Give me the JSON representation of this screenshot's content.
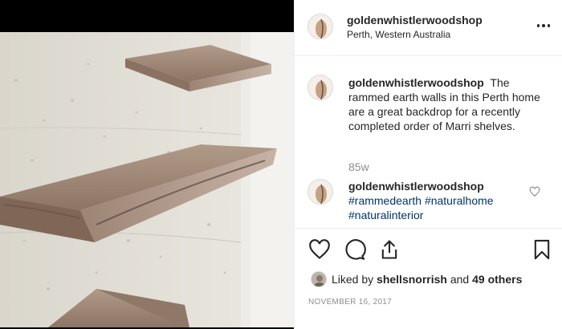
{
  "post": {
    "username": "goldenwhistlerwoodshop",
    "location": "Perth, Western Australia",
    "image_alt": "Marri timber floating shelves on a rammed earth wall"
  },
  "caption": {
    "username": "goldenwhistlerwoodshop",
    "text": "The rammed earth walls in this Perth home are a great backdrop for a recently completed order of Marri shelves.",
    "time_ago": "85w"
  },
  "comment": {
    "username": "goldenwhistlerwoodshop",
    "hashtags": [
      "#rammedearth",
      "#naturalhome",
      "#naturalinterior"
    ]
  },
  "likes": {
    "prefix": "Liked by",
    "user": "shellsnorrish",
    "connector": "and",
    "others": "49 others"
  },
  "date": "November 16, 2017",
  "icons": {
    "more": "more-options-icon",
    "like": "heart-icon",
    "comment": "comment-bubble-icon",
    "share": "share-icon",
    "save": "bookmark-icon",
    "comment_like": "small-heart-icon"
  }
}
